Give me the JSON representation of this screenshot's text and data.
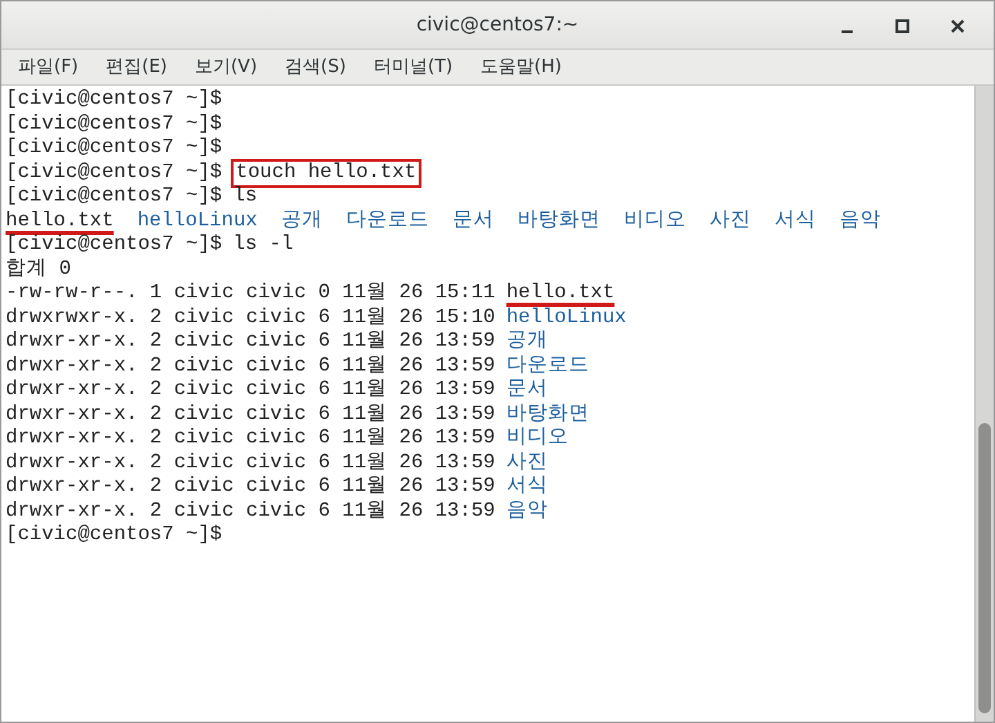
{
  "window": {
    "title": "civic@centos7:~"
  },
  "menu": [
    "파일(F)",
    "편집(E)",
    "보기(V)",
    "검색(S)",
    "터미널(T)",
    "도움말(H)"
  ],
  "terminal": {
    "lines": [
      {
        "kind": "prompt",
        "prompt": "[civic@centos7 ~]$"
      },
      {
        "kind": "prompt",
        "prompt": "[civic@centos7 ~]$"
      },
      {
        "kind": "prompt",
        "prompt": "[civic@centos7 ~]$"
      },
      {
        "kind": "prompt",
        "prompt": "[civic@centos7 ~]$",
        "command": "touch hello.txt",
        "boxed": true
      },
      {
        "kind": "prompt",
        "prompt": "[civic@centos7 ~]$",
        "command": "ls",
        "boxed": false
      },
      {
        "kind": "listing",
        "items": [
          {
            "name": "hello.txt",
            "kind": "file",
            "underlined": true
          },
          {
            "name": "helloLinux",
            "kind": "dir",
            "underlined": false
          },
          {
            "name": "공개",
            "kind": "dir",
            "underlined": false
          },
          {
            "name": "다운로드",
            "kind": "dir",
            "underlined": false
          },
          {
            "name": "문서",
            "kind": "dir",
            "underlined": false
          },
          {
            "name": "바탕화면",
            "kind": "dir",
            "underlined": false
          },
          {
            "name": "비디오",
            "kind": "dir",
            "underlined": false
          },
          {
            "name": "사진",
            "kind": "dir",
            "underlined": false
          },
          {
            "name": "서식",
            "kind": "dir",
            "underlined": false
          },
          {
            "name": "음악",
            "kind": "dir",
            "underlined": false
          }
        ]
      },
      {
        "kind": "prompt",
        "prompt": "[civic@centos7 ~]$",
        "command": "ls -l",
        "boxed": false
      },
      {
        "kind": "text",
        "text": "합계 0"
      },
      {
        "kind": "long",
        "meta": "-rw-rw-r--. 1 civic civic 0 11월 26 15:11",
        "name": "hello.txt",
        "directory": false,
        "underlined": true
      },
      {
        "kind": "long",
        "meta": "drwxrwxr-x. 2 civic civic 6 11월 26 15:10",
        "name": "helloLinux",
        "directory": true,
        "underlined": false
      },
      {
        "kind": "long",
        "meta": "drwxr-xr-x. 2 civic civic 6 11월 26 13:59",
        "name": "공개",
        "directory": true,
        "underlined": false
      },
      {
        "kind": "long",
        "meta": "drwxr-xr-x. 2 civic civic 6 11월 26 13:59",
        "name": "다운로드",
        "directory": true,
        "underlined": false
      },
      {
        "kind": "long",
        "meta": "drwxr-xr-x. 2 civic civic 6 11월 26 13:59",
        "name": "문서",
        "directory": true,
        "underlined": false
      },
      {
        "kind": "long",
        "meta": "drwxr-xr-x. 2 civic civic 6 11월 26 13:59",
        "name": "바탕화면",
        "directory": true,
        "underlined": false
      },
      {
        "kind": "long",
        "meta": "drwxr-xr-x. 2 civic civic 6 11월 26 13:59",
        "name": "비디오",
        "directory": true,
        "underlined": false
      },
      {
        "kind": "long",
        "meta": "drwxr-xr-x. 2 civic civic 6 11월 26 13:59",
        "name": "사진",
        "directory": true,
        "underlined": false
      },
      {
        "kind": "long",
        "meta": "drwxr-xr-x. 2 civic civic 6 11월 26 13:59",
        "name": "서식",
        "directory": true,
        "underlined": false
      },
      {
        "kind": "long",
        "meta": "drwxr-xr-x. 2 civic civic 6 11월 26 13:59",
        "name": "음악",
        "directory": true,
        "underlined": false
      },
      {
        "kind": "prompt",
        "prompt": "[civic@centos7 ~]$"
      }
    ]
  }
}
